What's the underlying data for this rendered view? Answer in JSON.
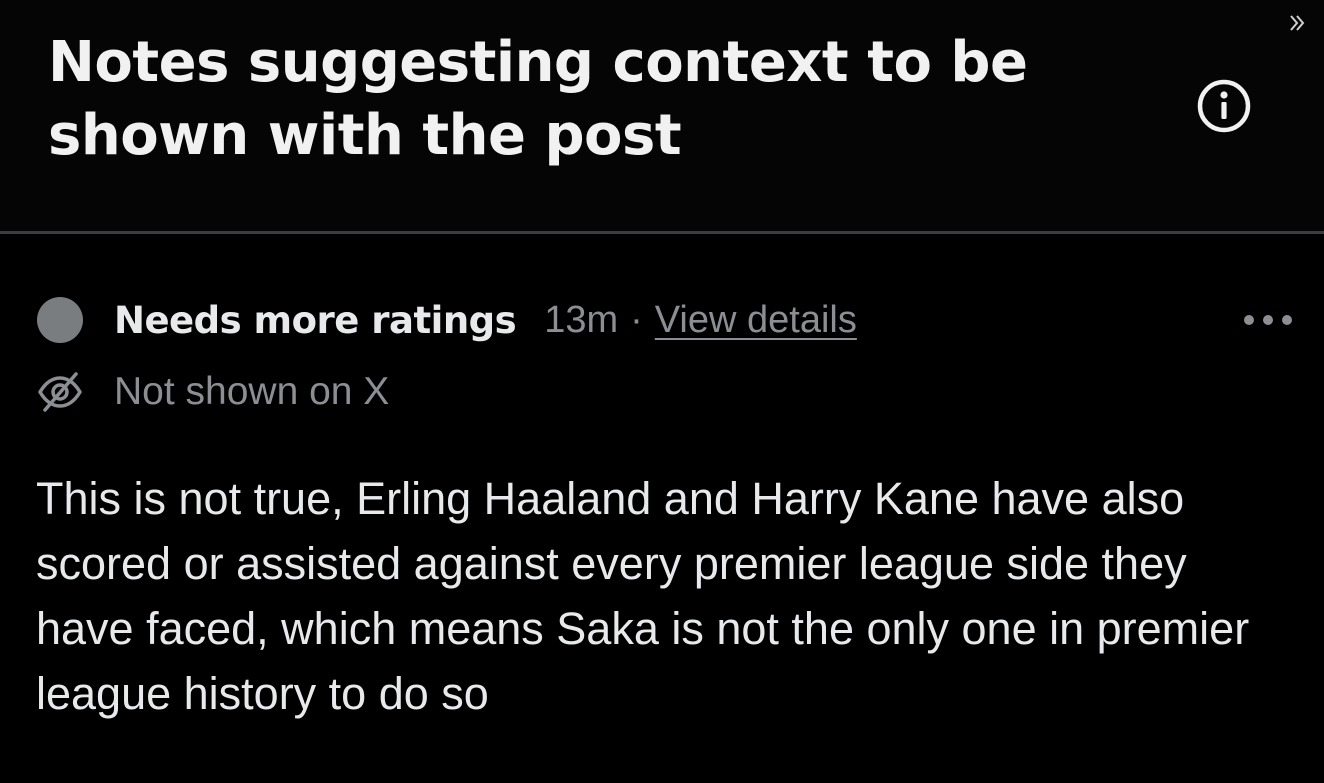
{
  "header": {
    "title": "Notes suggesting context to be shown with the post",
    "info_icon": "info-circle-icon",
    "expand_icon": "double-chevron-right-icon"
  },
  "note": {
    "status_label": "Needs more ratings",
    "status_color": "#7a7d80",
    "time": "13m",
    "separator": "·",
    "view_details": "View details",
    "more_icon": "more-horizontal-icon",
    "visibility_icon": "eye-off-icon",
    "visibility_label": "Not shown on X",
    "text": "This is not true, Erling Haaland and Harry Kane have also scored or assisted against every premier league side they have faced, which means Saka is not the only one in premier league history to do so"
  },
  "colors": {
    "background": "#000000",
    "primary_text": "#e7e9ea",
    "secondary_text": "#8b8f93",
    "divider": "#3a3c3f"
  }
}
